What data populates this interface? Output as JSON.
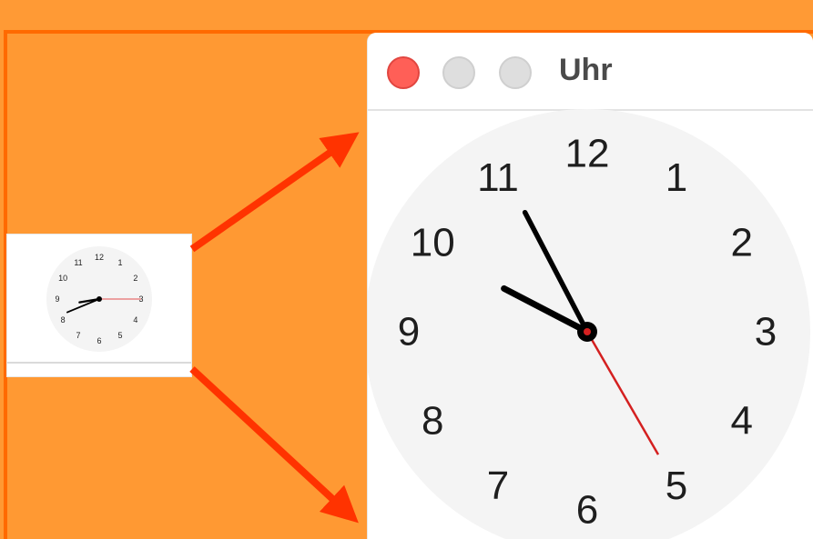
{
  "window": {
    "title": "Uhr",
    "buttons": [
      "close",
      "minimize",
      "zoom"
    ]
  },
  "clock": {
    "numerals": [
      "12",
      "1",
      "2",
      "3",
      "4",
      "5",
      "6",
      "7",
      "8",
      "9",
      "10",
      "11"
    ],
    "time": {
      "hour": 9,
      "minute": 55,
      "second": 25
    },
    "colors": {
      "face": "#f4f4f4",
      "hands": "#000000",
      "second_hand": "#d42020"
    }
  },
  "thumbnail": {
    "time": {
      "hour": 8,
      "minute": 41,
      "second": 15
    }
  },
  "colors": {
    "background": "#ff9933",
    "border": "#ff6a00",
    "arrow": "#ff3300",
    "close_button": "#ff5f57"
  }
}
